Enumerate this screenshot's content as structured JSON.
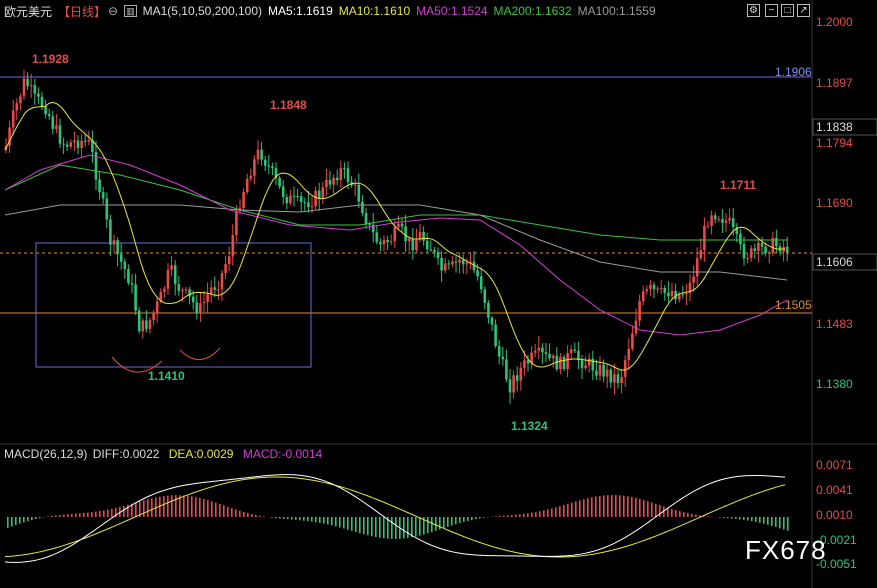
{
  "header": {
    "symbol": "欧元美元",
    "period": "【日线】",
    "ma_title": "MA1(5,10,50,200,100)",
    "ma5": "MA5:1.1619",
    "ma10": "MA10:1.1610",
    "ma50": "MA50:1.1524",
    "ma200": "MA200:1.1632",
    "ma100": "MA100:1.1559"
  },
  "macd_header": {
    "title": "MACD(26,12,9)",
    "diff": "DIFF:0.0022",
    "dea": "DEA:0.0029",
    "macd": "MACD:-0.0014"
  },
  "price_axis": [
    "1.2000",
    "1.1897",
    "1.1794",
    "1.1690",
    "1.1483",
    "1.1380"
  ],
  "price_tags": {
    "current": "1.1838",
    "last": "1.1606",
    "h_line_top": "1.1906",
    "h_line_mid": "1.1505"
  },
  "macd_axis": [
    "0.0071",
    "0.0041",
    "0.0010",
    "-0.0021",
    "-0.0051"
  ],
  "annotations": {
    "high1": "1.1928",
    "high2": "1.1848",
    "high3": "1.1711",
    "low1": "1.1410",
    "low2": "1.1324"
  },
  "watermark": "FX678",
  "colors": {
    "up": "#e8494a",
    "down": "#2fc27a",
    "ma5": "#ffffff",
    "ma10": "#e6e63c",
    "ma50": "#d63cd6",
    "ma200": "#39c43c",
    "ma100": "#9a9a9a",
    "hline_blue": "#6b6bd8",
    "hline_orange": "#e08a3a"
  }
}
